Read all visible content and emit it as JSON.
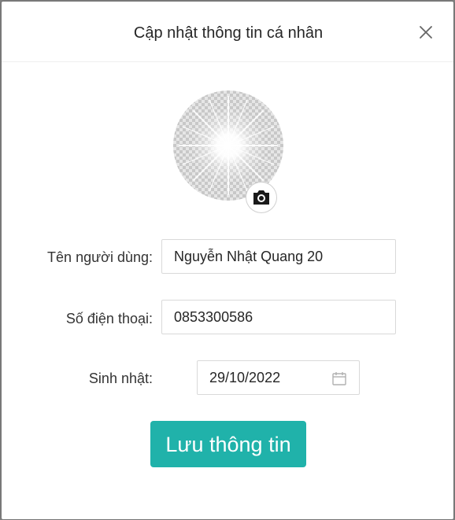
{
  "dialog": {
    "title": "Cập nhật thông tin cá nhân"
  },
  "form": {
    "username": {
      "label": "Tên người dùng",
      "value": "Nguyễn Nhật Quang 20"
    },
    "phone": {
      "label": "Số điện thoại",
      "value": "0853300586"
    },
    "birthday": {
      "label": "Sinh nhật",
      "value": "29/10/2022"
    },
    "label_separator": ":"
  },
  "actions": {
    "save_label": "Lưu thông tin"
  },
  "icons": {
    "close": "close-icon",
    "camera": "camera-icon",
    "calendar": "calendar-icon"
  },
  "colors": {
    "primary": "#20b2aa",
    "border": "#d9d9d9",
    "text": "#262626"
  }
}
